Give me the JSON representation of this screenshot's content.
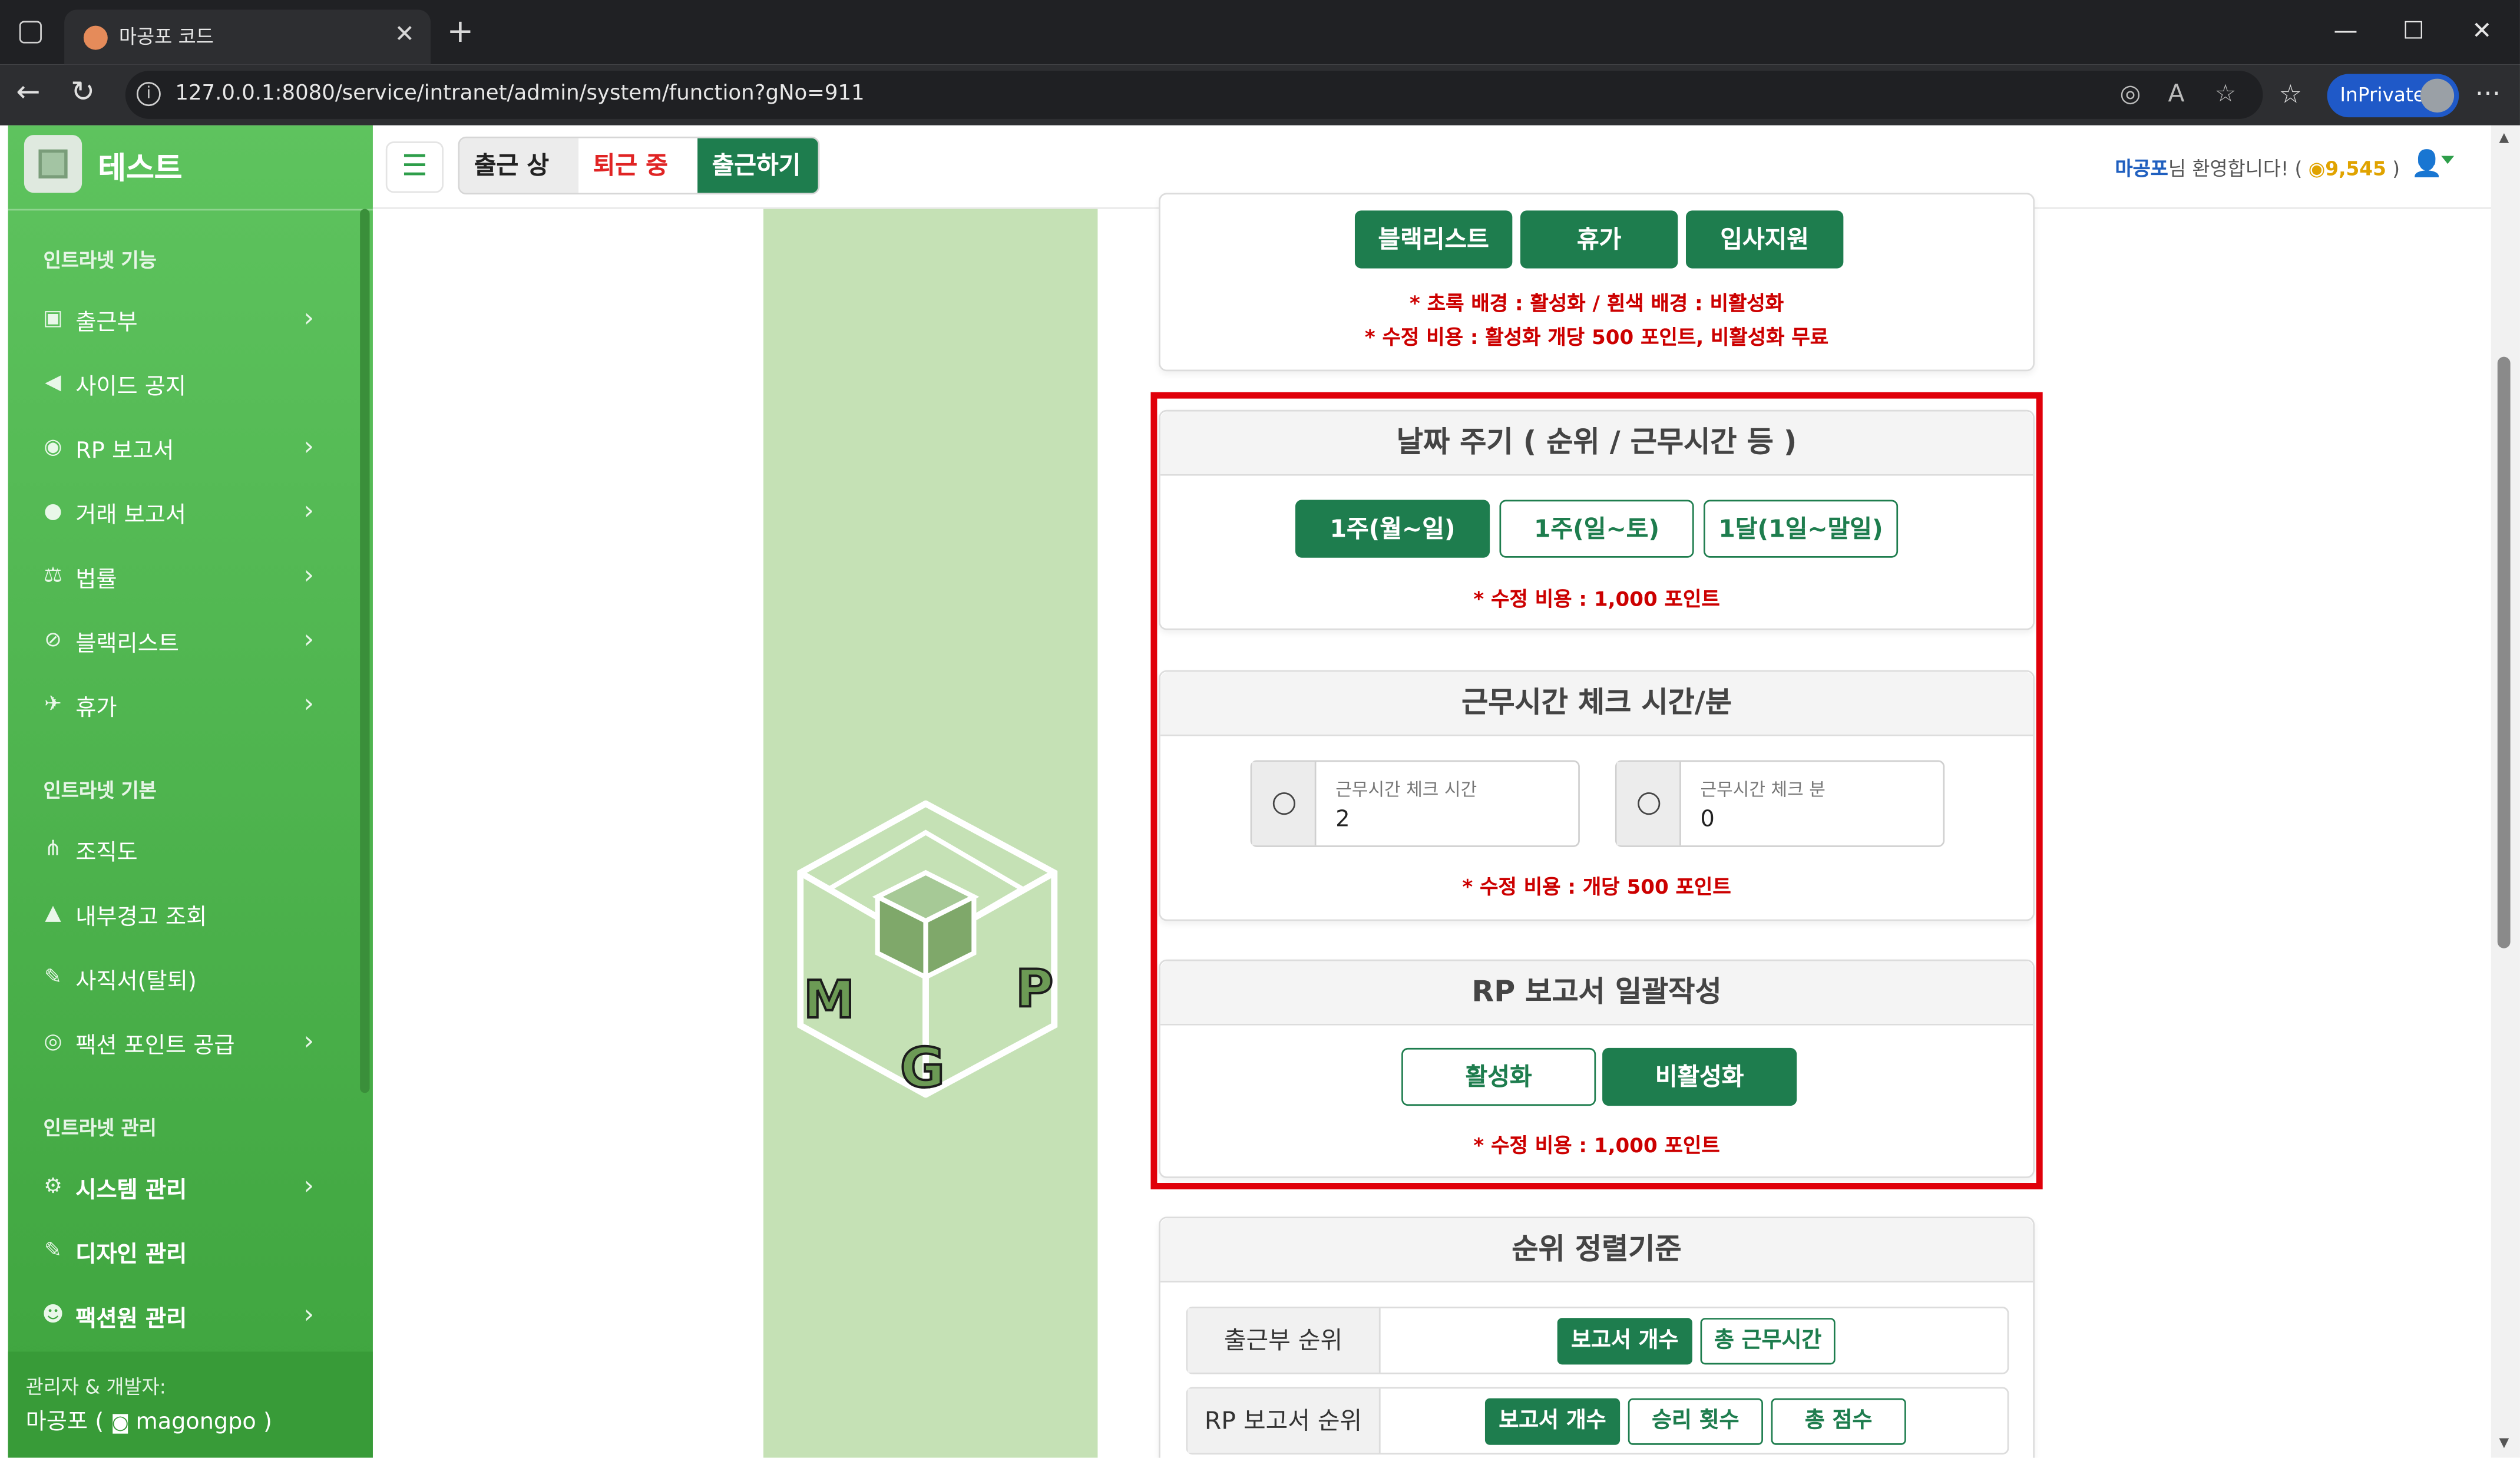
{
  "browser": {
    "tab_title": "마공포 코드",
    "url": "127.0.0.1:8080/service/intranet/admin/system/function?gNo=911",
    "inprivate_label": "InPrivate"
  },
  "sidebar": {
    "brand": "테스트",
    "sections": [
      "인트라넷 기능",
      "인트라넷 기본",
      "인트라넷 관리"
    ],
    "items": [
      {
        "label": "출근부"
      },
      {
        "label": "사이드 공지"
      },
      {
        "label": "RP 보고서"
      },
      {
        "label": "거래 보고서"
      },
      {
        "label": "법률"
      },
      {
        "label": "블랙리스트"
      },
      {
        "label": "휴가"
      },
      {
        "label": "조직도"
      },
      {
        "label": "내부경고 조회"
      },
      {
        "label": "사직서(탈퇴)"
      },
      {
        "label": "팩션 포인트 공급"
      },
      {
        "label": "시스템 관리"
      },
      {
        "label": "디자인 관리"
      },
      {
        "label": "팩션원 관리"
      }
    ],
    "footer_title": "관리자 & 개발자:",
    "footer_name": "마공포 ( ",
    "footer_discord": "magongpo )"
  },
  "appbar": {
    "status_label": "출근 상태",
    "status_value": "퇴근 중",
    "checkin_button": "출근하기",
    "welcome_name": "마공포",
    "welcome_text": "님 환영합니다! ( ",
    "points": "9,545",
    "welcome_end": " )"
  },
  "top_card": {
    "buttons": [
      "블랙리스트",
      "휴가",
      "입사지원"
    ],
    "note1": "* 초록 배경 : 활성화 / 흰색 배경 : 비활성화",
    "note2": "* 수정 비용 : 활성화 개당 500 포인트, 비활성화 무료"
  },
  "date_cycle": {
    "title": "날짜 주기 ( 순위 / 근무시간 등 )",
    "options": [
      "1주(월~일)",
      "1주(일~토)",
      "1달(1일~말일)"
    ],
    "selected": "1주(월~일)",
    "note": "* 수정 비용 : 1,000 포인트"
  },
  "work_check": {
    "title": "근무시간 체크 시간/분",
    "hour_label": "근무시간 체크 시간",
    "hour_value": "2",
    "minute_label": "근무시간 체크 분",
    "minute_value": "0",
    "note": "* 수정 비용 : 개당 500 포인트"
  },
  "rp_batch": {
    "title": "RP 보고서 일괄작성",
    "enable_label": "활성화",
    "disable_label": "비활성화",
    "selected": "비활성화",
    "note": "* 수정 비용 : 1,000 포인트"
  },
  "rank_sort": {
    "title": "순위 정렬기준",
    "rows": [
      {
        "label": "출근부 순위",
        "options": [
          "보고서 개수",
          "총 근무시간"
        ],
        "selected": "보고서 개수"
      },
      {
        "label": "RP 보고서 순위",
        "options": [
          "보고서 개수",
          "승리 횟수",
          "총 점수"
        ],
        "selected": "보고서 개수"
      }
    ]
  },
  "logo_letters": [
    "M",
    "G",
    "P"
  ],
  "colors": {
    "accent": "#1e7d4e",
    "sidebar": "#4caf50",
    "highlight": "#e0000a",
    "warning": "#cc0000"
  }
}
